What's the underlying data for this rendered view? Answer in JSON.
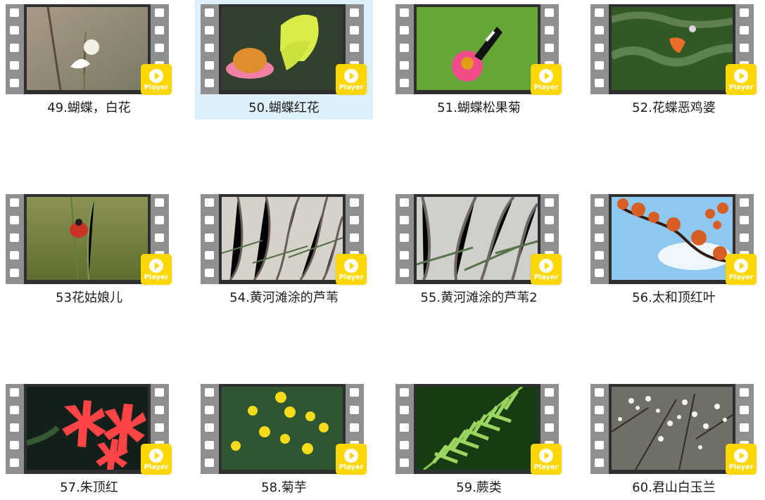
{
  "badge_label": "Player",
  "items": [
    {
      "caption": "49.蝴蝶，白花",
      "selected": false,
      "icon": "white-flower-butterfly"
    },
    {
      "caption": "50.蝴蝶红花",
      "selected": true,
      "icon": "yellow-butterfly-pink-flower"
    },
    {
      "caption": "51.蝴蝶松果菊",
      "selected": false,
      "icon": "black-white-butterfly-zinnia"
    },
    {
      "caption": "52.花蝶恶鸡婆",
      "selected": false,
      "icon": "orange-butterfly-thistle"
    },
    {
      "caption": "53花姑娘儿",
      "selected": false,
      "icon": "ladybug-grass"
    },
    {
      "caption": "54.黄河滩涂的芦苇",
      "selected": false,
      "icon": "reeds"
    },
    {
      "caption": "55.黄河滩涂的芦苇2",
      "selected": false,
      "icon": "reeds-closeup"
    },
    {
      "caption": "56.太和顶红叶",
      "selected": false,
      "icon": "red-leaves-sky"
    },
    {
      "caption": "57.朱顶红",
      "selected": false,
      "icon": "red-amaryllis"
    },
    {
      "caption": "58.菊芋",
      "selected": false,
      "icon": "sunflowers"
    },
    {
      "caption": "59.蕨类",
      "selected": false,
      "icon": "fern"
    },
    {
      "caption": "60.君山白玉兰",
      "selected": false,
      "icon": "white-magnolia"
    }
  ],
  "colors": {
    "selected_bg": "#dff0fd",
    "badge": "#ffd700",
    "film": "#9a9a9a",
    "frame": "#2f2f2f"
  }
}
